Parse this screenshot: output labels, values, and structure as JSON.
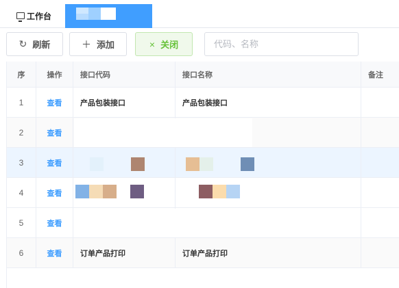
{
  "tabs": {
    "home_icon": "desktop-icon",
    "home_label": "工作台"
  },
  "toolbar": {
    "refresh_label": "刷新",
    "add_label": "添加",
    "close_label": "关闭",
    "refresh_glyph": "↻",
    "add_glyph": "＋",
    "close_glyph": "×"
  },
  "search": {
    "placeholder": "代码、名称",
    "value": ""
  },
  "table": {
    "headers": {
      "seq": "序",
      "op": "操作",
      "code": "接口代码",
      "name": "接口名称",
      "note": "备注"
    },
    "rows": [
      {
        "seq": "1",
        "op": "查看",
        "code": "产品包装接口",
        "name": "产品包装接口",
        "note": ""
      },
      {
        "seq": "2",
        "op": "查看",
        "code": "",
        "name": "",
        "note": ""
      },
      {
        "seq": "3",
        "op": "查看",
        "code": "",
        "name": "",
        "note": ""
      },
      {
        "seq": "4",
        "op": "查看",
        "code": "",
        "name": "",
        "note": ""
      },
      {
        "seq": "5",
        "op": "查看",
        "code": "",
        "name": "",
        "note": ""
      },
      {
        "seq": "6",
        "op": "查看",
        "code": "订单产品打印",
        "name": "订单产品打印",
        "note": ""
      }
    ]
  },
  "colors": {
    "accent": "#409eff",
    "success": "#67c23a"
  }
}
